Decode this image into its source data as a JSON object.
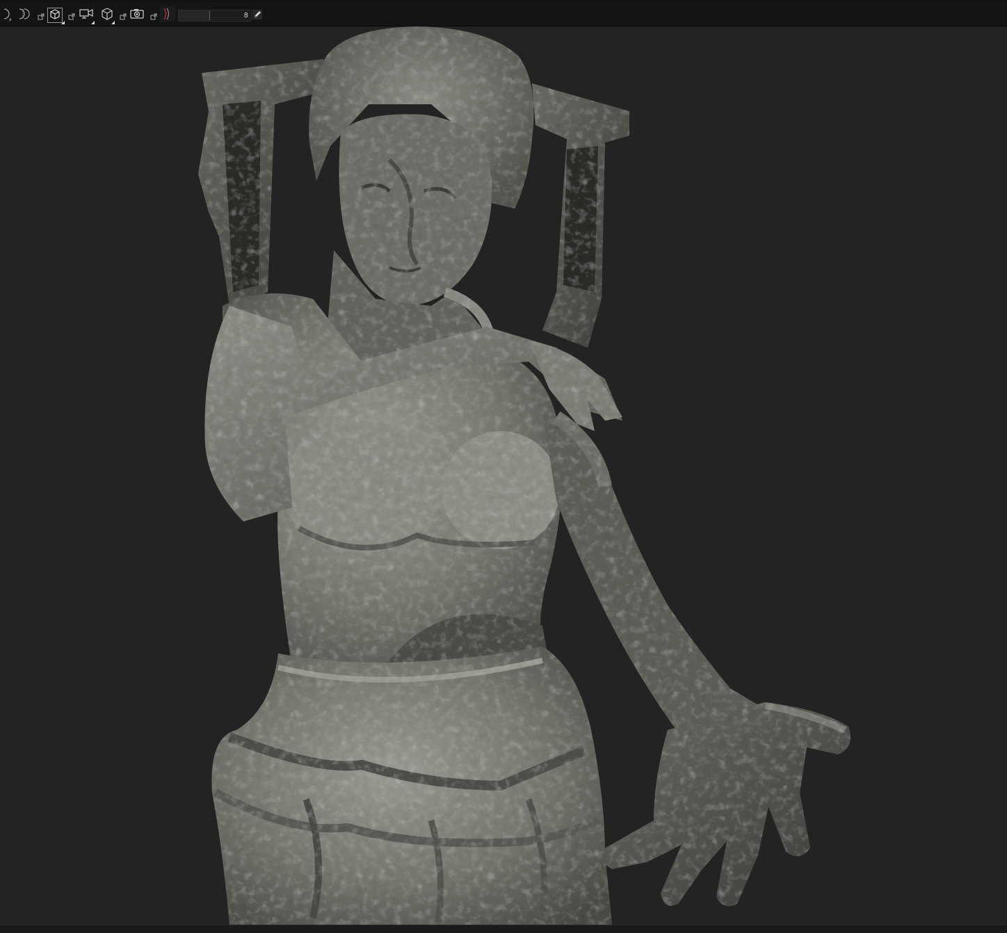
{
  "toolbar": {
    "icons": [
      "sphere-x-icon",
      "half-sphere-icon",
      "external-link-icon",
      "cube-icon",
      "external-link-icon",
      "camera-display-icon",
      "external-link-icon",
      "cube-outline-icon",
      "external-link-icon",
      "screenshot-camera-icon",
      "external-link-icon",
      "brush-bracket-icon",
      "pencil-icon"
    ],
    "slider": {
      "value_label": "8",
      "fraction": 0.42
    }
  },
  "viewport": {
    "content": "3d-statue-render",
    "background_color": "#232323",
    "stone_color": "#7a7a74"
  }
}
